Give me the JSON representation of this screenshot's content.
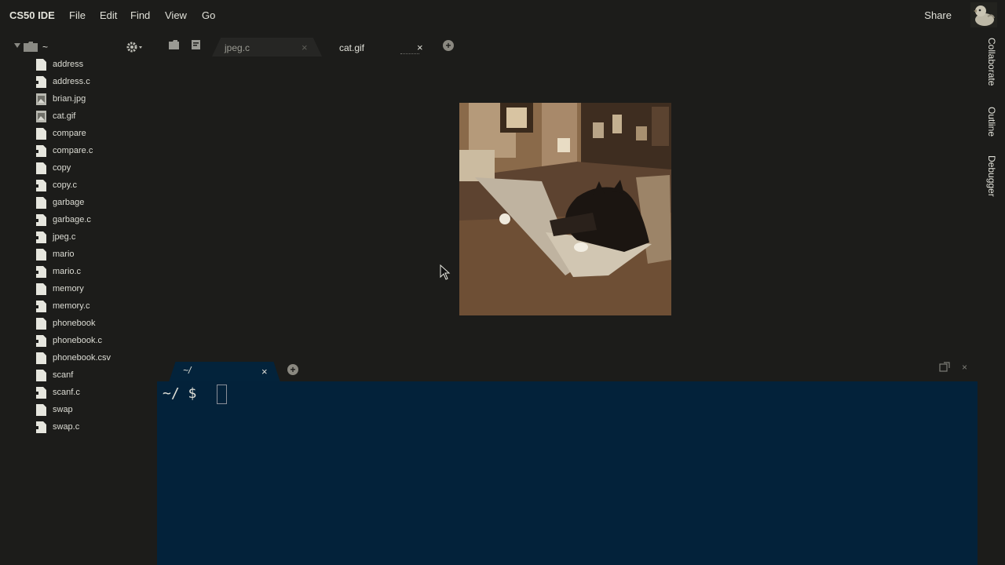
{
  "menubar": {
    "brand": "CS50 IDE",
    "items": [
      "File",
      "Edit",
      "Find",
      "View",
      "Go"
    ],
    "share_label": "Share"
  },
  "right_panel": {
    "tabs": [
      "Collaborate",
      "Outline",
      "Debugger"
    ]
  },
  "workspace": {
    "root_label": "~",
    "files": [
      {
        "name": "address",
        "icon": "file-icon"
      },
      {
        "name": "address.c",
        "icon": "c-file-icon"
      },
      {
        "name": "brian.jpg",
        "icon": "image-file-icon"
      },
      {
        "name": "cat.gif",
        "icon": "image-file-icon"
      },
      {
        "name": "compare",
        "icon": "file-icon"
      },
      {
        "name": "compare.c",
        "icon": "c-file-icon"
      },
      {
        "name": "copy",
        "icon": "file-icon"
      },
      {
        "name": "copy.c",
        "icon": "c-file-icon"
      },
      {
        "name": "garbage",
        "icon": "file-icon"
      },
      {
        "name": "garbage.c",
        "icon": "c-file-icon"
      },
      {
        "name": "jpeg.c",
        "icon": "c-file-icon"
      },
      {
        "name": "mario",
        "icon": "file-icon"
      },
      {
        "name": "mario.c",
        "icon": "c-file-icon"
      },
      {
        "name": "memory",
        "icon": "file-icon"
      },
      {
        "name": "memory.c",
        "icon": "c-file-icon"
      },
      {
        "name": "phonebook",
        "icon": "file-icon"
      },
      {
        "name": "phonebook.c",
        "icon": "c-file-icon"
      },
      {
        "name": "phonebook.csv",
        "icon": "file-icon"
      },
      {
        "name": "scanf",
        "icon": "file-icon"
      },
      {
        "name": "scanf.c",
        "icon": "c-file-icon"
      },
      {
        "name": "swap",
        "icon": "file-icon"
      },
      {
        "name": "swap.c",
        "icon": "c-file-icon"
      }
    ]
  },
  "editor": {
    "tabs": [
      {
        "label": "jpeg.c",
        "active": false,
        "close": "×"
      },
      {
        "label": "cat.gif",
        "active": true,
        "close": "×"
      }
    ],
    "add_tab": "+"
  },
  "terminal": {
    "tab_label": "~/",
    "tab_close": "×",
    "add_tab": "+",
    "prompt": "~/ $ ",
    "close_panel": "×"
  },
  "colors": {
    "background": "#1c1c1a",
    "terminal_bg": "#03223a",
    "text": "#e0e0d8"
  }
}
